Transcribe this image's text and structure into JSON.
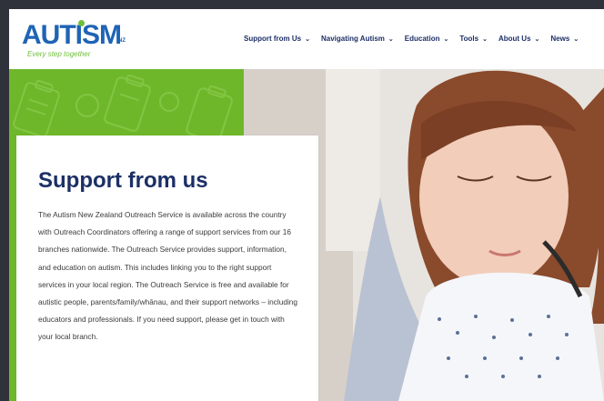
{
  "logo": {
    "word": "AUTISM",
    "suffix": "NZ",
    "tagline": "Every step together"
  },
  "nav": {
    "items": [
      {
        "label": "Support from Us"
      },
      {
        "label": "Navigating Autism"
      },
      {
        "label": "Education"
      },
      {
        "label": "Tools"
      },
      {
        "label": "About Us"
      },
      {
        "label": "News"
      }
    ],
    "chevron": "⌄"
  },
  "hero": {
    "title": "Support from us",
    "body": "The Autism New Zealand Outreach Service is available across the country with Outreach Coordinators offering a range of support services from our 16 branches nationwide. The Outreach Service provides support, information, and education on autism. This includes linking you to the right support services in your local region. The Outreach Service is free and available for autistic people, parents/family/whānau, and their support networks – including educators and professionals. If you need support, please get in touch with your local branch.",
    "photo_subject": "girl-reading-icon"
  },
  "colors": {
    "brand_blue": "#1f64b5",
    "brand_green": "#6ebf3a",
    "nav_text": "#1c2f66",
    "panel_green": "#6fb72a"
  }
}
